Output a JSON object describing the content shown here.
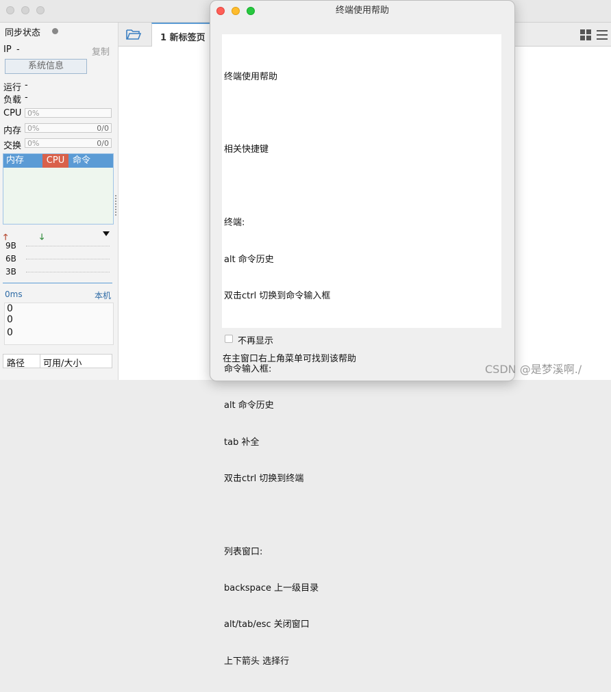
{
  "dialog": {
    "title": "终端使用帮助",
    "help_lines": [
      "终端使用帮助",
      "",
      "相关快捷键",
      "",
      "终端:",
      "alt 命令历史",
      "双击ctrl 切换到命令输入框",
      "",
      "命令输入框:",
      "alt 命令历史",
      "tab 补全",
      "双击ctrl 切换到终端",
      "",
      "列表窗口:",
      "backspace 上一级目录",
      "alt/tab/esc 关闭窗口",
      "上下箭头 选择行"
    ],
    "dont_show_label": "不再显示",
    "footer_text": "在主窗口右上角菜单可找到该帮助"
  },
  "left": {
    "sync_status": "同步状态",
    "ip_label": "IP",
    "ip_value": "-",
    "copy_label": "复制",
    "sysinfo_button": "系统信息",
    "run_label": "运行",
    "run_value": "-",
    "load_label": "负载",
    "load_value": "-",
    "cpu_label": "CPU",
    "cpu_value": "0%",
    "mem_label": "内存",
    "mem_value": "0%",
    "mem_ratio": "0/0",
    "swap_label": "交换",
    "swap_value": "0%",
    "swap_ratio": "0/0",
    "proc_headers": [
      "内存",
      "CPU",
      "命令"
    ],
    "net_levels": [
      "9B",
      "6B",
      "3B"
    ],
    "ping_label": "0ms",
    "ping_host": "本机",
    "ping_values": [
      "0",
      "0",
      "0"
    ],
    "disk_headers": [
      "路径",
      "可用/大小"
    ]
  },
  "tabs": {
    "active_label": "1 新标签页"
  },
  "watermark": "CSDN @是梦溪啊./",
  "colors": {
    "accent_blue": "#5b9bd5",
    "cpu_red": "#d9614b",
    "close_red": "#ff5f57",
    "min_yellow": "#febc2e",
    "max_green": "#28c840"
  }
}
